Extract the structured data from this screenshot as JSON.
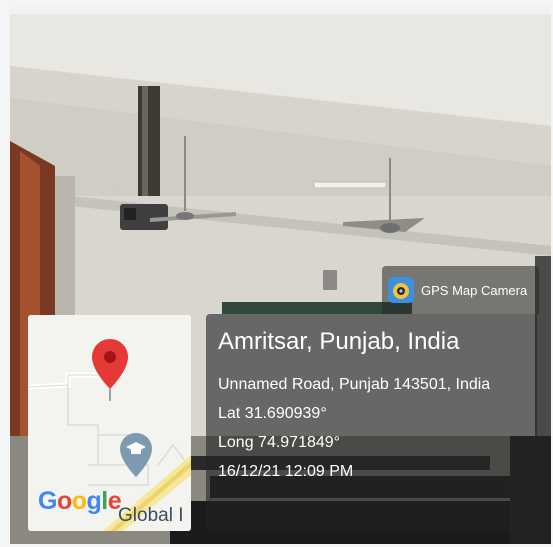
{
  "badge": {
    "app_name": "GPS Map Camera",
    "icon": "gps-map-camera-icon"
  },
  "map": {
    "brand_letters": [
      "G",
      "o",
      "o",
      "g",
      "l",
      "e"
    ],
    "brand_colors": [
      "#4285F4",
      "#EA4335",
      "#FBBC05",
      "#4285F4",
      "#34A853",
      "#EA4335"
    ],
    "poi_label": "Global I",
    "pin_icon": "map-pin-icon",
    "poi_icon": "school-marker-icon"
  },
  "location": {
    "place": "Amritsar, Punjab, India",
    "address": "Unnamed Road, Punjab 143501, India",
    "lat": "Lat 31.690939°",
    "long": "Long 74.971849°",
    "datetime": "16/12/21 12:09 PM"
  },
  "colors": {
    "pin": "#E53935",
    "panel": "#232323"
  }
}
